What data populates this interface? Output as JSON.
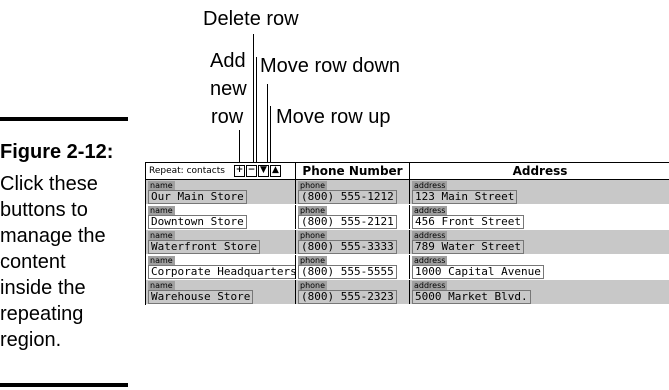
{
  "callouts": {
    "delete_row": "Delete row",
    "add": "Add",
    "new": "new",
    "row": "row",
    "move_down": "Move row down",
    "move_up": "Move row up"
  },
  "caption": {
    "title": "Figure 2-12:",
    "lines": [
      "Click these",
      "buttons to",
      "manage the",
      "content",
      "inside the",
      "repeating",
      "region."
    ]
  },
  "table": {
    "repeat_label": "Repeat: contacts",
    "buttons": [
      "+",
      "−",
      "▼",
      "▲"
    ],
    "headers": [
      "Phone Number",
      "Address"
    ],
    "field_labels": {
      "name": "name",
      "phone": "phone",
      "address": "address"
    },
    "rows": [
      {
        "name": "Our Main Store",
        "phone": "(800) 555-1212",
        "address": "123 Main Street"
      },
      {
        "name": "Downtown Store",
        "phone": "(800) 555-2121",
        "address": "456 Front Street"
      },
      {
        "name": "Waterfront Store",
        "phone": "(800) 555-3333",
        "address": "789 Water Street"
      },
      {
        "name": "Corporate Headquarters",
        "phone": "(800) 555-5555",
        "address": "1000 Capital Avenue"
      },
      {
        "name": "Warehouse Store",
        "phone": "(800) 555-2323",
        "address": "5000 Market Blvd."
      }
    ]
  }
}
